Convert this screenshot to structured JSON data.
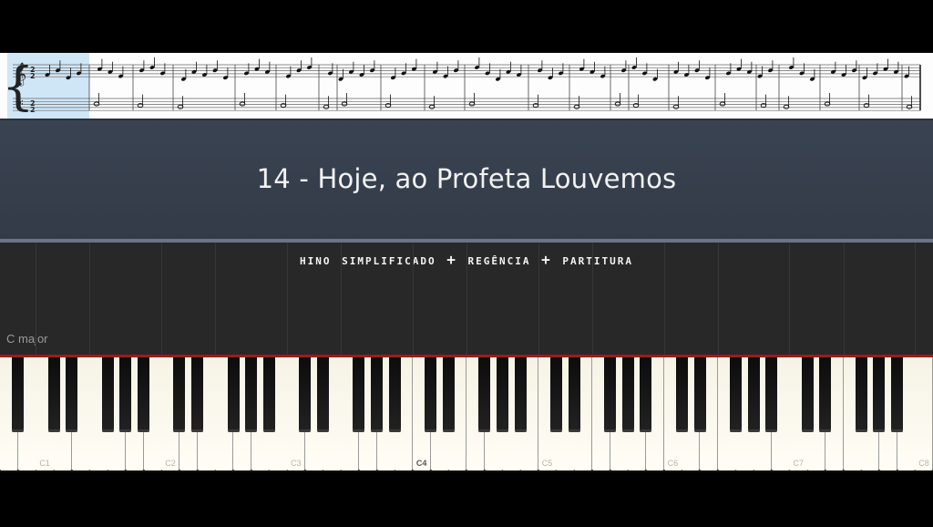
{
  "score": {
    "label": "sheet-music-strip",
    "time_signature": "2/2"
  },
  "title": "14 - Hoje, ao Profeta Louvemos",
  "subtitle": "hino simplificado + regência + partitura",
  "key_label": "C major",
  "octave_labels": [
    "C1",
    "C2",
    "C3",
    "C4",
    "C5",
    "C6",
    "C7",
    "C8"
  ],
  "colors": {
    "panel": "#3a4352",
    "highlight": "#cfe6f7",
    "hit_line": "#a11a1a"
  }
}
